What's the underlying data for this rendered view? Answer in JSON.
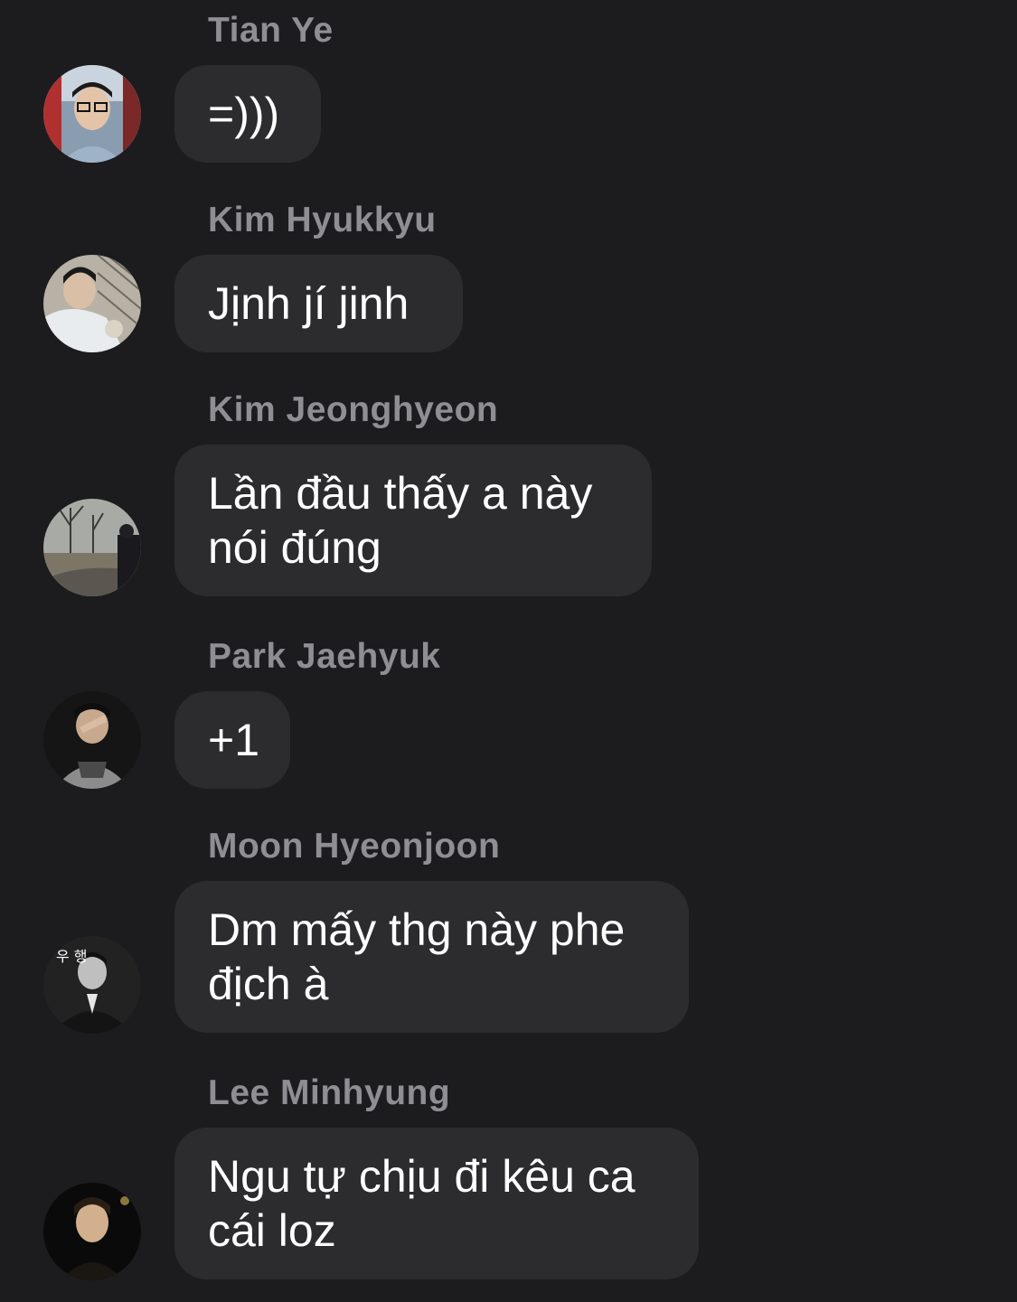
{
  "messages": [
    {
      "sender": "Tian Ye",
      "avatar_icon": "avatar-tian-ye",
      "text": "=)))"
    },
    {
      "sender": "Kim Hyukkyu",
      "avatar_icon": "avatar-kim-hyukkyu",
      "text": "Jịnh jí jinh"
    },
    {
      "sender": "Kim Jeonghyeon",
      "avatar_icon": "avatar-kim-jeonghyeon",
      "text": "Lần đầu thấy a này nói đúng"
    },
    {
      "sender": "Park Jaehyuk",
      "avatar_icon": "avatar-park-jaehyuk",
      "text": "+1"
    },
    {
      "sender": "Moon Hyeonjoon",
      "avatar_icon": "avatar-moon-hyeonjoon",
      "avatar_text": "우 행",
      "text": "Dm mấy thg này phe địch à"
    },
    {
      "sender": "Lee Minhyung",
      "avatar_icon": "avatar-lee-minhyung",
      "text": "Ngu tự chịu đi kêu ca cái loz"
    }
  ],
  "colors": {
    "background": "#1c1c1e",
    "bubble": "#2c2c2e",
    "sender_text": "#8e8e93",
    "message_text": "#ffffff"
  }
}
